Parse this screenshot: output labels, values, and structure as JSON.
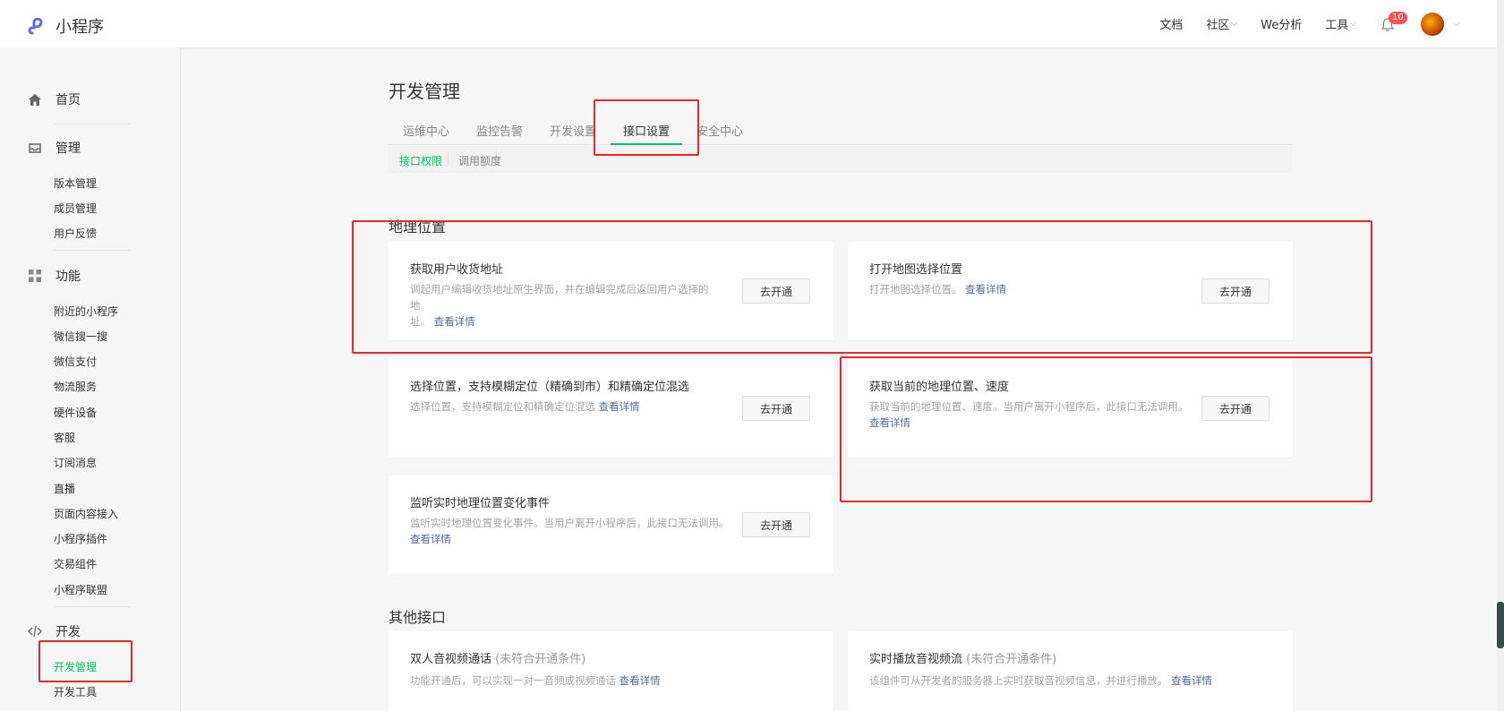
{
  "topbar": {
    "logo_text": "小程序",
    "nav": {
      "docs": "文档",
      "community": "社区",
      "analytics": "We分析",
      "tools": "工具",
      "notification_count": "10"
    }
  },
  "sidebar": {
    "groups": {
      "home": "首页",
      "manage": "管理",
      "features": "功能",
      "dev": "开发"
    },
    "manage_items": [
      "版本管理",
      "成员管理",
      "用户反馈"
    ],
    "feature_items": [
      "附近的小程序",
      "微信搜一搜",
      "微信支付",
      "物流服务",
      "硬件设备",
      "客服",
      "订阅消息",
      "直播",
      "页面内容接入",
      "小程序插件",
      "交易组件",
      "小程序联盟"
    ],
    "dev_items": [
      "开发管理",
      "开发工具"
    ]
  },
  "main": {
    "title": "开发管理",
    "tabs": [
      "运维中心",
      "监控告警",
      "开发设置",
      "接口设置",
      "安全中心"
    ],
    "subtabs": [
      "接口权限",
      "调用额度"
    ],
    "section_geo": "地理位置",
    "section_other": "其他接口",
    "open_button": "去开通",
    "detail_link": "查看详情",
    "geo_cards": [
      {
        "title": "获取用户收货地址",
        "desc_line1": "调起用户编辑收货地址原生界面，并在编辑完成后返回用户选择的地",
        "desc_line2": "址。"
      },
      {
        "title": "打开地图选择位置",
        "desc_line1": "打开地图选择位置。"
      },
      {
        "title": "选择位置，支持模糊定位（精确到市）和精确定位混选",
        "desc_line1": "选择位置，支持模糊定位和精确定位混选"
      },
      {
        "title": "获取当前的地理位置、速度",
        "desc_line1": "获取当前的地理位置、速度。当用户离开小程序后，此接口无法调用。"
      },
      {
        "title": "监听实时地理位置变化事件",
        "desc_line1": "监听实时地理位置变化事件。当用户离开小程序后，此接口无法调用。"
      }
    ],
    "other_cards": [
      {
        "title": "双人音视频通话",
        "note": "(未符合开通条件)",
        "desc_line1": "功能开通后，可以实现一对一音频或视频通话"
      },
      {
        "title": "实时播放音视频流",
        "note": "(未符合开通条件)",
        "desc_line1": "该组件可从开发者的服务器上实时获取音视频信息，并进行播放。"
      }
    ]
  }
}
